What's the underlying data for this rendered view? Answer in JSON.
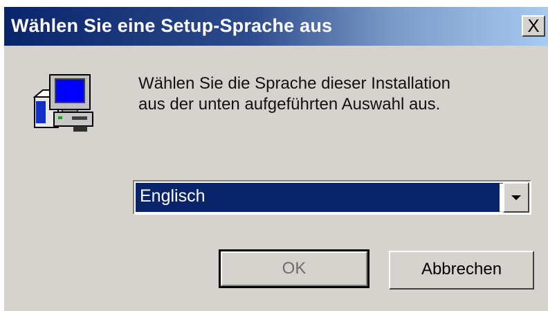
{
  "window": {
    "title": "Wählen Sie eine Setup-Sprache aus",
    "close_label": "X"
  },
  "message": {
    "line1": "Wählen Sie die Sprache dieser Installation",
    "line2": "aus der unten aufgeführten Auswahl aus."
  },
  "language_select": {
    "selected": "Englisch"
  },
  "buttons": {
    "ok_label": "OK",
    "cancel_label": "Abbrechen"
  },
  "icons": {
    "setup": "computer-setup-icon",
    "dropdown": "chevron-down-icon"
  },
  "colors": {
    "titlebar_start": "#0a246a",
    "titlebar_end": "#a6caf0",
    "face": "#d6d3ce",
    "selection": "#0a246a"
  }
}
